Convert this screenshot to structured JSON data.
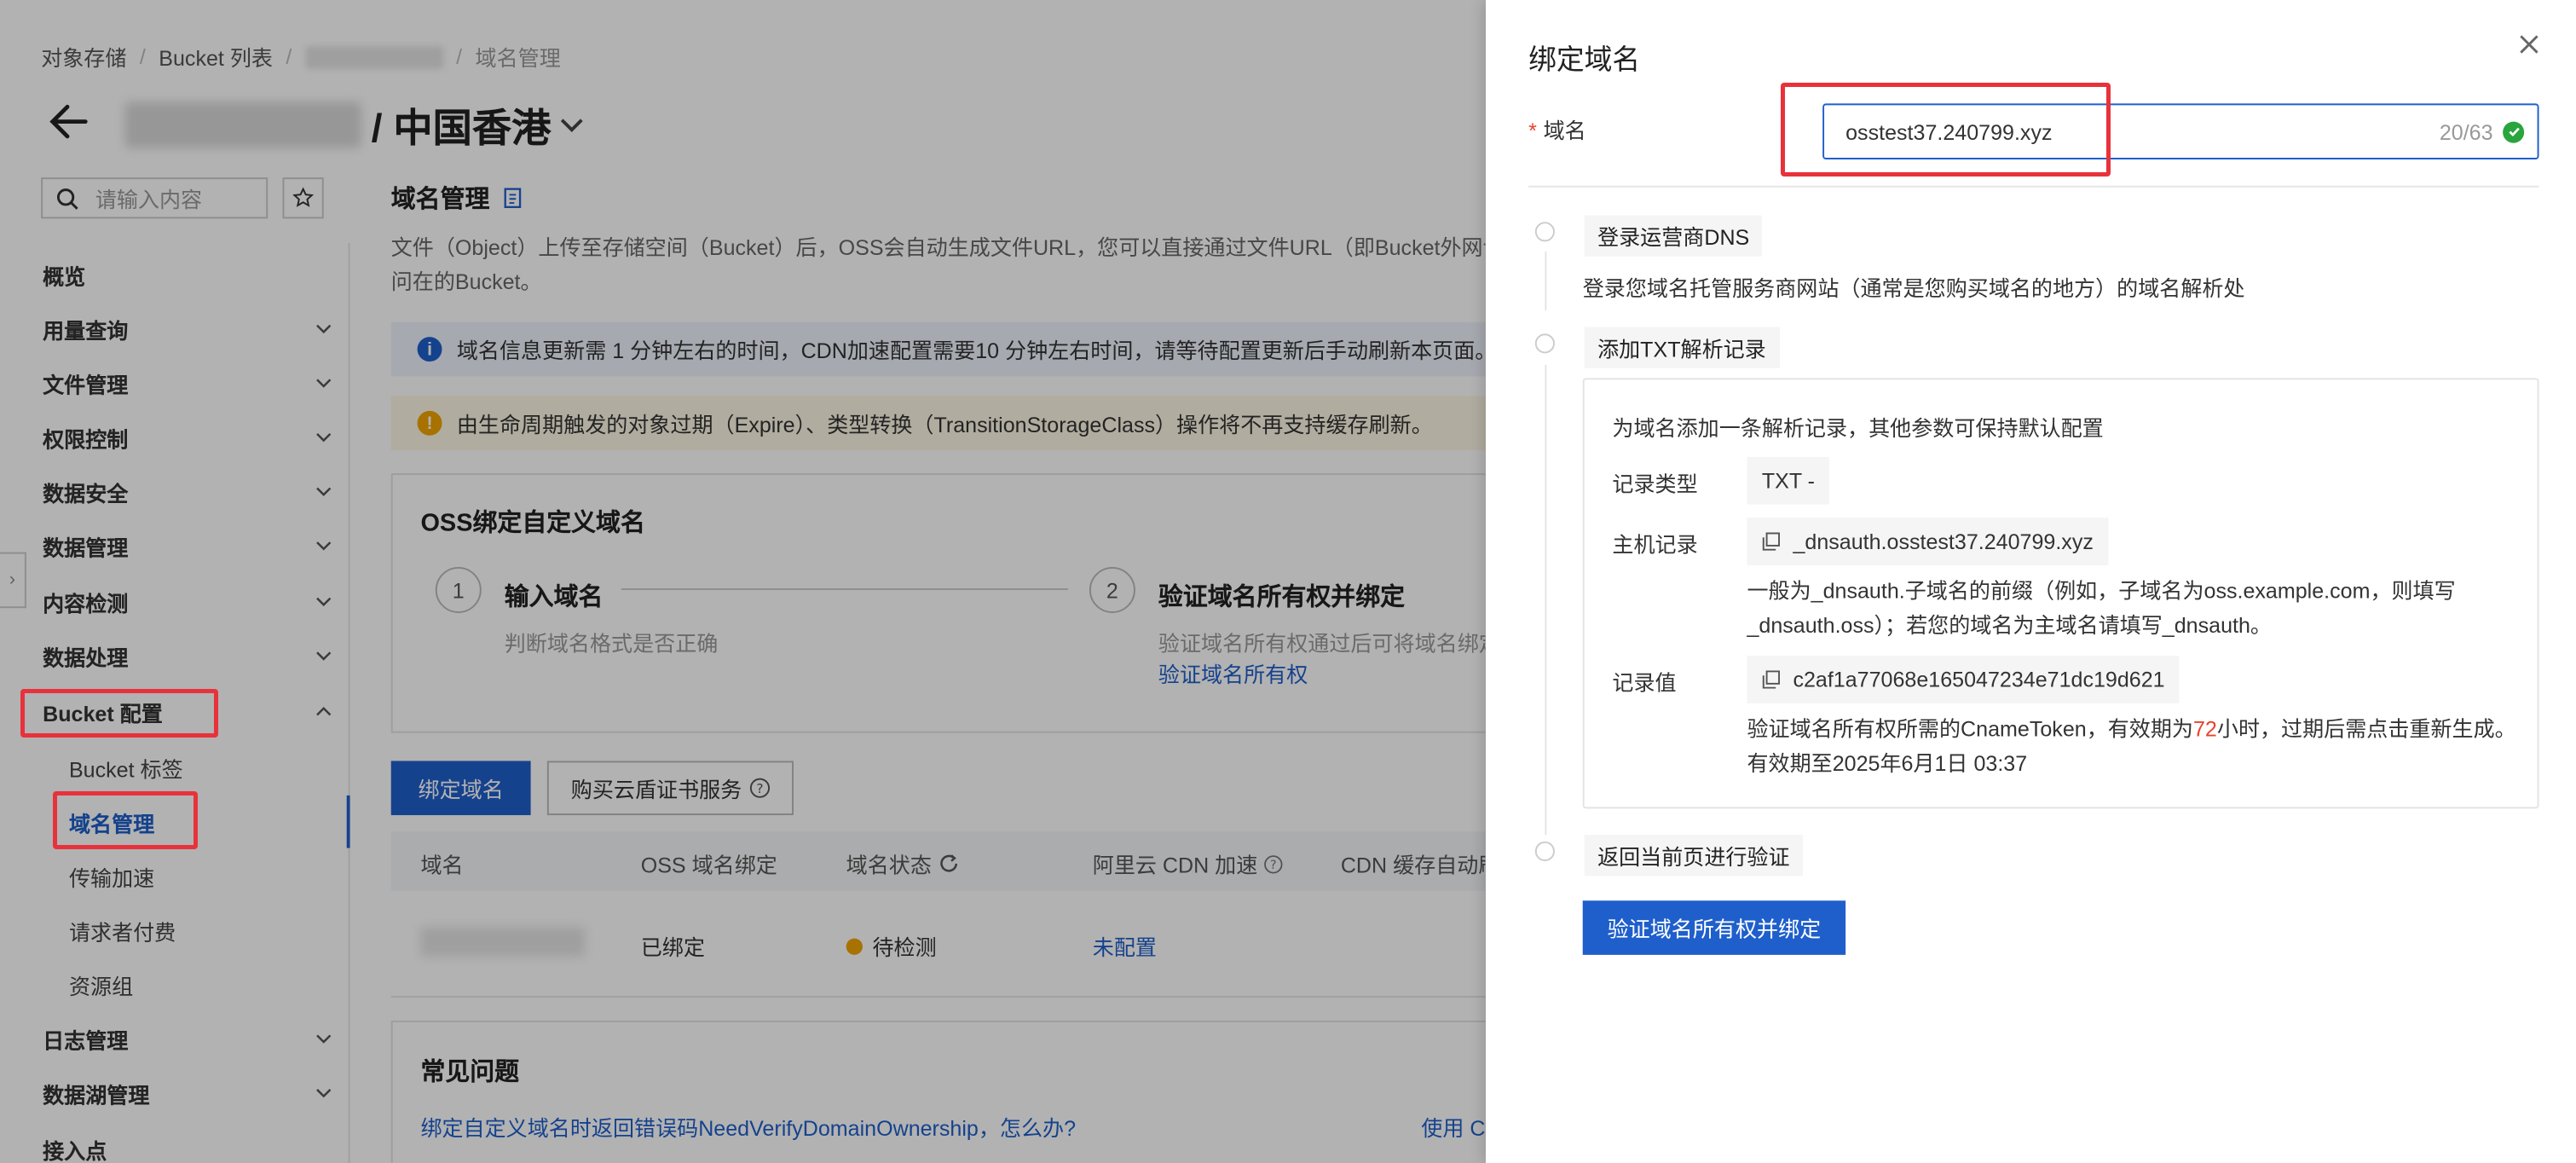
{
  "breadcrumb": {
    "root": "对象存储",
    "list": "Bucket 列表",
    "current": "域名管理"
  },
  "header": {
    "region_title": "/ 中国香港"
  },
  "sidebar": {
    "search_placeholder": "请输入内容",
    "items": [
      {
        "label": "概览"
      },
      {
        "label": "用量查询"
      },
      {
        "label": "文件管理"
      },
      {
        "label": "权限控制"
      },
      {
        "label": "数据安全"
      },
      {
        "label": "数据管理"
      },
      {
        "label": "内容检测"
      },
      {
        "label": "数据处理"
      },
      {
        "label": "Bucket 配置"
      }
    ],
    "sub_items": [
      {
        "label": "Bucket 标签"
      },
      {
        "label": "域名管理"
      },
      {
        "label": "传输加速"
      },
      {
        "label": "请求者付费"
      },
      {
        "label": "资源组"
      }
    ],
    "after_items": [
      {
        "label": "日志管理"
      },
      {
        "label": "数据湖管理"
      },
      {
        "label": "接入点"
      }
    ]
  },
  "main": {
    "section_title": "域名管理",
    "description": "文件（Object）上传至存储空间（Bucket）后，OSS会自动生成文件URL，您可以直接通过文件URL（即Bucket外网访问在的Bucket。",
    "banner_info": "域名信息更新需 1 分钟左右的时间，CDN加速配置需要10 分钟左右时间，请等待配置更新后手动刷新本页面。",
    "banner_warn": "由生命周期触发的对象过期（Expire）、类型转换（TransitionStorageClass）操作将不再支持缓存刷新。",
    "card_title": "OSS绑定自定义域名",
    "steps": [
      {
        "num": "1",
        "title": "输入域名",
        "desc": "判断域名格式是否正确"
      },
      {
        "num": "2",
        "title": "验证域名所有权并绑定",
        "desc": "验证域名所有权通过后可将域名绑定",
        "link": "验证域名所有权"
      }
    ],
    "bind_button": "绑定域名",
    "buy_button": "购买云盾证书服务",
    "table": {
      "headers": [
        "域名",
        "OSS 域名绑定",
        "域名状态",
        "阿里云 CDN 加速",
        "CDN 缓存自动刷"
      ],
      "row": {
        "bind": "已绑定",
        "status": "待检测",
        "cdn": "未配置"
      }
    },
    "faq_title": "常见问题",
    "faq_link": "绑定自定义域名时返回错误码NeedVerifyDomainOwnership，怎么办?",
    "faq_link2": "使用 C"
  },
  "drawer": {
    "title": "绑定域名",
    "field_label": "域名",
    "input_value": "osstest37.240799.xyz",
    "input_count": "20/63",
    "step1": {
      "tag": "登录运营商DNS",
      "text": "登录您域名托管服务商网站（通常是您购买域名的地方）的域名解析处"
    },
    "step2": {
      "tag": "添加TXT解析记录",
      "intro": "为域名添加一条解析记录，其他参数可保持默认配置",
      "record_type_label": "记录类型",
      "record_type_value": "TXT -",
      "host_label": "主机记录",
      "host_value": "_dnsauth.osstest37.240799.xyz",
      "host_note_1": "一般为_dnsauth.子域名的前缀（例如，子域名为oss.example.com，则填写",
      "host_note_2": "_dnsauth.oss）；若您的域名为主域名请填写_dnsauth。",
      "value_label": "记录值",
      "value_value": "c2af1a77068e165047234e71dc19d621",
      "value_note_pre": "验证域名所有权所需的CnameToken，有效期为",
      "value_note_hours": "72",
      "value_note_post": "小时，过期后需点击重新生成。",
      "value_note_2": "有效期至2025年6月1日 03:37"
    },
    "step3": {
      "tag": "返回当前页进行验证"
    },
    "verify_button": "验证域名所有权并绑定"
  },
  "colors": {
    "primary": "#1f5fcb",
    "annotation": "#e8323b",
    "success": "#2aa53e",
    "pending": "#f0a400"
  }
}
